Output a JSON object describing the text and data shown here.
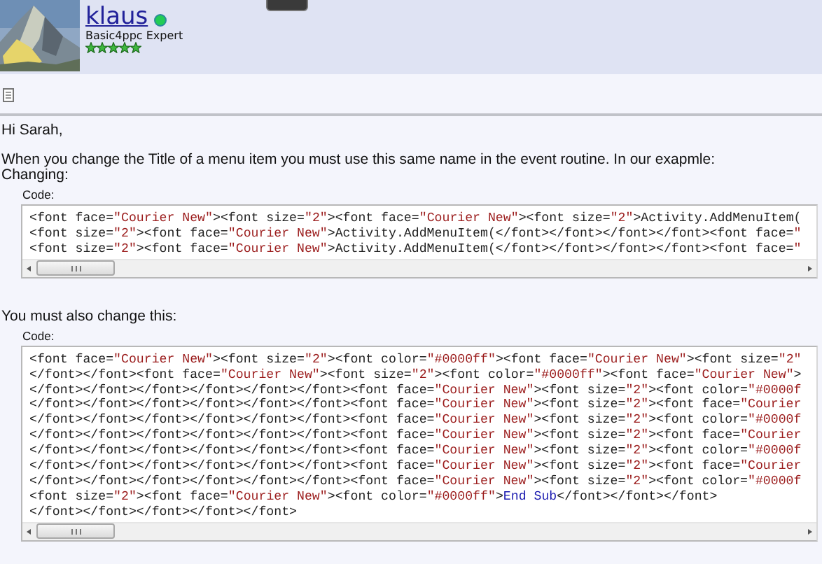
{
  "user": {
    "kind": "picture",
    "name": "klaus",
    "online": true,
    "rank": "Basic4ppc Expert",
    "stars": 5
  },
  "post": {
    "greeting": "Hi Sarah,",
    "paragraphs": [
      "When you change the Title of a menu item you must use this same name in the event routine. In our exapmle:",
      "Changing:"
    ],
    "blocks": [
      {
        "label": "Code:",
        "lines": [
          [
            {
              "kind": "tag",
              "text": "<font face=\"Courier New\"><font size=\"2\"><font face=\"Courier New\"><font size=\"2\">Activity.AddMenuItem("
            }
          ],
          [
            {
              "kind": "tag",
              "text": "<font size=\"2\"><font face=\"Courier New\">Activity.AddMenuItem(</font></font></font></font><font face=\""
            }
          ],
          [
            {
              "kind": "tag",
              "text": "<font size=\"2\"><font face=\"Courier New\">Activity.AddMenuItem(</font></font></font></font><font face=\""
            }
          ]
        ]
      },
      {
        "intro": "You must also change this:",
        "label": "Code:",
        "lines": [
          [
            {
              "kind": "tag",
              "text": "<font face=\"Courier New\"><font size=\"2\"><font color=\"#0000ff\"><font face=\"Courier New\"><font size=\"2\""
            }
          ],
          [
            {
              "kind": "tag",
              "text": "</font></font><font face=\"Courier New\"><font size=\"2\"><font color=\"#0000ff\"><font face=\"Courier New\">"
            }
          ],
          [
            {
              "kind": "tag",
              "text": "</font></font></font></font></font></font><font face=\"Courier New\"><font size=\"2\"><font color=\"#0000f"
            }
          ],
          [
            {
              "kind": "tag",
              "text": "</font></font></font></font></font></font><font face=\"Courier New\"><font size=\"2\"><font face=\"Courier"
            }
          ],
          [
            {
              "kind": "tag",
              "text": "</font></font></font></font></font></font><font face=\"Courier New\"><font size=\"2\"><font color=\"#0000f"
            }
          ],
          [
            {
              "kind": "tag",
              "text": "</font></font></font></font></font></font><font face=\"Courier New\"><font size=\"2\"><font face=\"Courier"
            }
          ],
          [
            {
              "kind": "tag",
              "text": "</font></font></font></font></font></font><font face=\"Courier New\"><font size=\"2\"><font color=\"#0000f"
            }
          ],
          [
            {
              "kind": "tag",
              "text": "</font></font></font></font></font></font><font face=\"Courier New\"><font size=\"2\"><font face=\"Courier"
            }
          ],
          [
            {
              "kind": "tag",
              "text": "</font></font></font></font></font></font><font face=\"Courier New\"><font size=\"2\"><font color=\"#0000f"
            }
          ],
          [
            {
              "kind": "tag",
              "text": "<font size=\"2\"><font face=\"Courier New\"><font color=\"#0000ff\">"
            },
            {
              "kind": "keyword",
              "text": "End Sub"
            },
            {
              "kind": "tag",
              "text": "</font></font></font>"
            }
          ],
          [
            {
              "kind": "tag",
              "text": "</font></font></font></font></font>"
            }
          ]
        ]
      }
    ]
  }
}
